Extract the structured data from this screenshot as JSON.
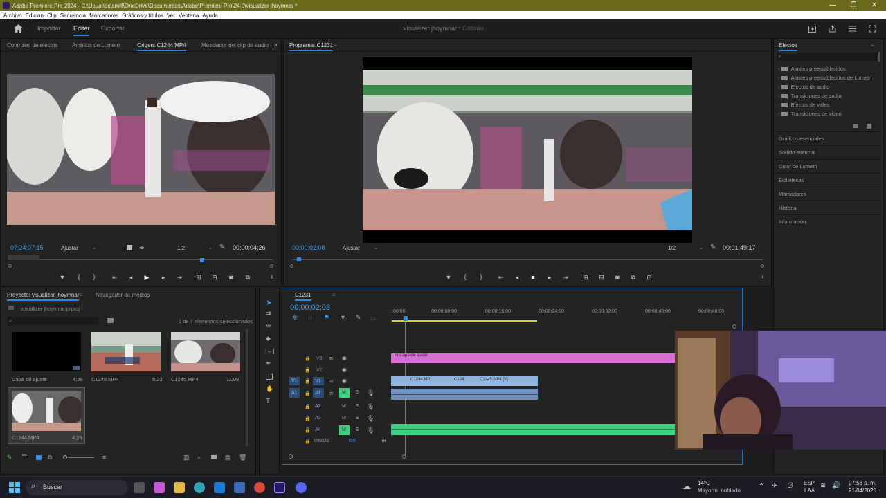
{
  "window": {
    "title": "Adobe Premiere Pro 2024 - C:\\Usuarios\\smill\\OneDrive\\Documentos\\Adobe\\Premiere Pro\\24.0\\visualizer jhoymnar *",
    "minimize": "—",
    "maximize": "❐",
    "close": "✕"
  },
  "menu": [
    "Archivo",
    "Edición",
    "Clip",
    "Secuencia",
    "Marcadores",
    "Gráficos y títulos",
    "Ver",
    "Ventana",
    "Ayuda"
  ],
  "header": {
    "home_icon": "home-icon",
    "tabs": [
      "Importar",
      "Editar",
      "Exportar"
    ],
    "active_tab": "Editar",
    "project_name": "visualizer jhoymnar",
    "status": "Editado"
  },
  "source_panel": {
    "tabs": [
      "Controles de efectos",
      "Ámbitos de Lumetri",
      "Origen: C1244.MP4",
      "Mezclador del clip de audio"
    ],
    "active_tab": "Origen: C1244.MP4",
    "timecode": "07;24;07;15",
    "fit": "Ajustar",
    "resolution": "1/2",
    "duration": "00;00;04;26"
  },
  "program_panel": {
    "title": "Programa: C1231",
    "timecode": "00;00;02;08",
    "fit": "Ajustar",
    "resolution": "1/2",
    "duration": "00;01;49;17"
  },
  "project_panel": {
    "tabs": [
      "Proyecto: visualizer jhoymnar",
      "Navegador de medios"
    ],
    "file": "visualizer jhoymnar.prproj",
    "selection_info": "1 de 7 elementos seleccionados",
    "items": [
      {
        "name": "Capa de ajuste",
        "duration": "4;29"
      },
      {
        "name": "C1249.MP4",
        "duration": "8;23"
      },
      {
        "name": "C1245.MP4",
        "duration": "11;08"
      },
      {
        "name": "C1244.MP4",
        "duration": "4;26"
      }
    ]
  },
  "timeline": {
    "sequence": "C1231",
    "timecode": "00;00;02;08",
    "ruler": [
      ":00;00",
      "00;00;08;00",
      "00;00;16;00",
      "00;00;24;00",
      "00;00;32;00",
      "00;00;40;00",
      "00;00;48;00"
    ],
    "tracks": [
      "V3",
      "V2",
      "V1",
      "A1",
      "A2",
      "A3",
      "A4"
    ],
    "mix_label": "Mezcla",
    "mix_value": "0.0",
    "clips": {
      "adjustment": "Capa de ajuste",
      "v1_a": "C1244.MP",
      "v1_b": "C124",
      "v1_c": "C1245.MP4 [V]"
    },
    "m_label": "M",
    "s_label": "S"
  },
  "effects_panel": {
    "title": "Efectos",
    "folders": [
      "Ajustes preestablecidos",
      "Ajustes preestablecidos de Lumetri",
      "Efectos de audio",
      "Transiciones de audio",
      "Efectos de vídeo",
      "Transiciones de vídeo"
    ],
    "sections": [
      "Gráficos esenciales",
      "Sonido esencial",
      "Color de Lumetri",
      "Bibliotecas",
      "Marcadores",
      "Historial",
      "Información"
    ]
  },
  "taskbar": {
    "search": "Buscar",
    "weather_temp": "14°C",
    "weather_desc": "Mayorm. nublado",
    "lang": "ESP",
    "lang2": "LAA",
    "time": "07:56 p. m.",
    "date": "21/04/2026"
  },
  "colors": {
    "accent": "#2d8ceb",
    "titlebar": "#6b6a1c",
    "adjustment_clip": "#d96fd6",
    "video_clip": "#8fb4e0",
    "audio_clip": "#3ecf7f"
  }
}
